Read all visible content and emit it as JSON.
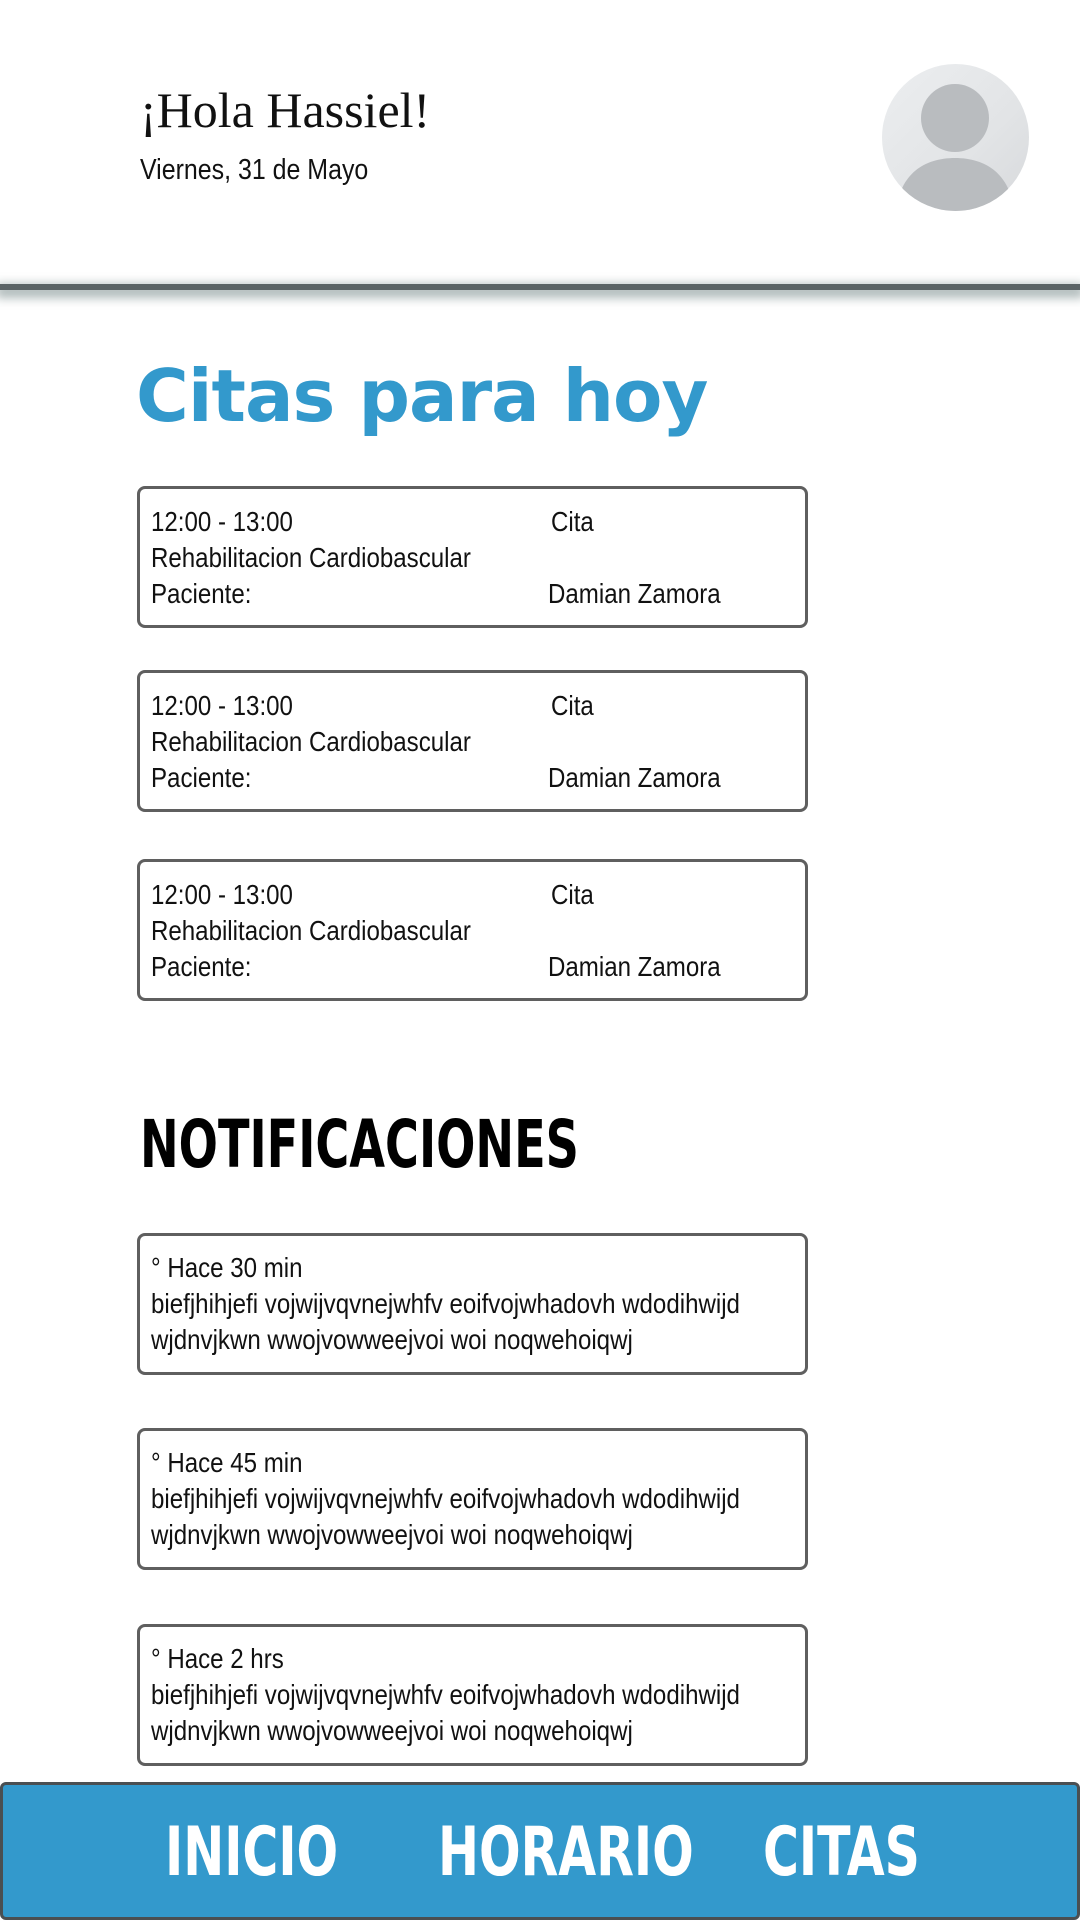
{
  "header": {
    "greeting": "¡Hola Hassiel!",
    "date": "Viernes, 31 de Mayo",
    "avatar_icon": "user-avatar-icon"
  },
  "appointments": {
    "title": "Citas para hoy",
    "items": [
      {
        "time": "12:00 - 13:00",
        "kind": "Cita",
        "service": "Rehabilitacion Cardiobascular",
        "patient_label": "Paciente:",
        "patient": "Damian Zamora"
      },
      {
        "time": "12:00 - 13:00",
        "kind": "Cita",
        "service": "Rehabilitacion Cardiobascular",
        "patient_label": "Paciente:",
        "patient": "Damian Zamora"
      },
      {
        "time": "12:00 - 13:00",
        "kind": "Cita",
        "service": "Rehabilitacion Cardiobascular",
        "patient_label": "Paciente:",
        "patient": "Damian Zamora"
      }
    ]
  },
  "notifications": {
    "title": "NOTIFICACIONES",
    "items": [
      {
        "when": "° Hace 30 min",
        "line1": "biefjhihjefi vojwijvqvnejwhfv eoifvojwhadovh wdodihwijd",
        "line2": "wjdnvjkwn wwojvowweejvoi woi noqwehoiqwj"
      },
      {
        "when": "° Hace 45 min",
        "line1": "biefjhihjefi vojwijvqvnejwhfv eoifvojwhadovh wdodihwijd",
        "line2": "wjdnvjkwn wwojvowweejvoi woi noqwehoiqwj"
      },
      {
        "when": "° Hace 2 hrs",
        "line1": "biefjhihjefi vojwijvqvnejwhfv eoifvojwhadovh wdodihwijd",
        "line2": "wjdnvjkwn wwojvowweejvoi woi noqwehoiqwj"
      }
    ]
  },
  "nav": {
    "inicio": "INICIO",
    "horario": "HORARIO",
    "citas": "CITAS"
  },
  "colors": {
    "accent": "#3399cc",
    "card_border": "#5f5f5f",
    "divider": "#5b6466"
  }
}
